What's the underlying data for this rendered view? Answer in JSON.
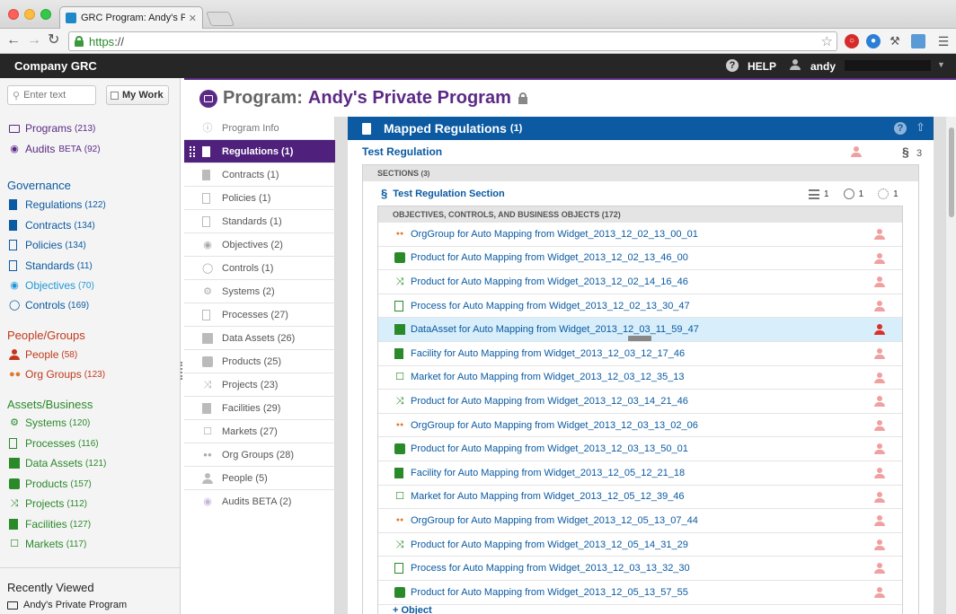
{
  "browser": {
    "tab_title": "GRC Program: Andy's Priva",
    "tab_close": "✕",
    "url_scheme": "https",
    "url_rest": "://"
  },
  "app": {
    "brand": "Company GRC",
    "help_label": "HELP",
    "user_name": "andy"
  },
  "sidebar": {
    "search_placeholder": "Enter text",
    "mywork_label": "My Work",
    "top_items": [
      {
        "label": "Programs",
        "count": "(213)",
        "color": "#5b2a86"
      },
      {
        "label": "Audits",
        "beta": "BETA",
        "count": "(92)",
        "color": "#5b2a86"
      }
    ],
    "governance": {
      "title": "Governance",
      "color": "#0b5aa2",
      "items": [
        {
          "label": "Regulations",
          "count": "(122)"
        },
        {
          "label": "Contracts",
          "count": "(134)"
        },
        {
          "label": "Policies",
          "count": "(134)"
        },
        {
          "label": "Standards",
          "count": "(11)"
        },
        {
          "label": "Objectives",
          "count": "(70)"
        },
        {
          "label": "Controls",
          "count": "(169)"
        }
      ]
    },
    "people_groups": {
      "title": "People/Groups",
      "color": "#c0391b",
      "items": [
        {
          "label": "People",
          "count": "(58)"
        },
        {
          "label": "Org Groups",
          "count": "(123)"
        }
      ]
    },
    "assets_business": {
      "title": "Assets/Business",
      "color": "#2a8a2a",
      "items": [
        {
          "label": "Systems",
          "count": "(120)"
        },
        {
          "label": "Processes",
          "count": "(116)"
        },
        {
          "label": "Data Assets",
          "count": "(121)"
        },
        {
          "label": "Products",
          "count": "(157)"
        },
        {
          "label": "Projects",
          "count": "(112)"
        },
        {
          "label": "Facilities",
          "count": "(127)"
        },
        {
          "label": "Markets",
          "count": "(117)"
        }
      ]
    },
    "recently_viewed": {
      "title": "Recently Viewed",
      "items": [
        "Andy's Private Program"
      ]
    }
  },
  "program": {
    "label": "Program:",
    "name": "Andy's Private Program"
  },
  "inner_nav": [
    {
      "label": "Program Info"
    },
    {
      "label": "Regulations (1)"
    },
    {
      "label": "Contracts (1)"
    },
    {
      "label": "Policies (1)"
    },
    {
      "label": "Standards (1)"
    },
    {
      "label": "Objectives (2)"
    },
    {
      "label": "Controls (1)"
    },
    {
      "label": "Systems (2)"
    },
    {
      "label": "Processes (27)"
    },
    {
      "label": "Data Assets (26)"
    },
    {
      "label": "Products (25)"
    },
    {
      "label": "Projects (23)"
    },
    {
      "label": "Facilities (29)"
    },
    {
      "label": "Markets (27)"
    },
    {
      "label": "Org Groups (28)"
    },
    {
      "label": "People (5)"
    },
    {
      "label": "Audits BETA (2)"
    }
  ],
  "panel": {
    "title": "Mapped Regulations",
    "count": "(1)",
    "regulation": "Test Regulation",
    "regulation_section_count": "3",
    "sections_label": "SECTIONS",
    "sections_count": "(3)",
    "section_name": "Test Regulation Section",
    "section_metrics": [
      "1",
      "1",
      "1"
    ],
    "objects_header": "OBJECTIVES, CONTROLS, AND BUSINESS OBJECTS (172)",
    "add_object": "+ Object",
    "objects": [
      {
        "type": "orggroup",
        "label": "OrgGroup for Auto Mapping from Widget_2013_12_02_13_00_01"
      },
      {
        "type": "product",
        "label": "Product for Auto Mapping from Widget_2013_12_02_13_46_00"
      },
      {
        "type": "project",
        "label": "Product for Auto Mapping from Widget_2013_12_02_14_16_46"
      },
      {
        "type": "process",
        "label": "Process for Auto Mapping from Widget_2013_12_02_13_30_47"
      },
      {
        "type": "dataasset",
        "label": "DataAsset for Auto Mapping from Widget_2013_12_03_11_59_47"
      },
      {
        "type": "facility",
        "label": "Facility for Auto Mapping from Widget_2013_12_03_12_17_46"
      },
      {
        "type": "market",
        "label": "Market for Auto Mapping from Widget_2013_12_03_12_35_13"
      },
      {
        "type": "project",
        "label": "Product for Auto Mapping from Widget_2013_12_03_14_21_46"
      },
      {
        "type": "orggroup",
        "label": "OrgGroup for Auto Mapping from Widget_2013_12_03_13_02_06"
      },
      {
        "type": "product",
        "label": "Product for Auto Mapping from Widget_2013_12_03_13_50_01"
      },
      {
        "type": "facility",
        "label": "Facility for Auto Mapping from Widget_2013_12_05_12_21_18"
      },
      {
        "type": "market",
        "label": "Market for Auto Mapping from Widget_2013_12_05_12_39_46"
      },
      {
        "type": "orggroup",
        "label": "OrgGroup for Auto Mapping from Widget_2013_12_05_13_07_44"
      },
      {
        "type": "project",
        "label": "Product for Auto Mapping from Widget_2013_12_05_14_31_29"
      },
      {
        "type": "process",
        "label": "Process for Auto Mapping from Widget_2013_12_03_13_32_30"
      },
      {
        "type": "product",
        "label": "Product for Auto Mapping from Widget_2013_12_05_13_57_55"
      }
    ]
  },
  "colors": {
    "program_purple": "#5b2a86",
    "link_blue": "#0b5aa2",
    "people_red": "#c0391b",
    "assets_green": "#2a8a2a",
    "owner_pink": "#f0a0a0",
    "owner_red": "#d9302c",
    "selected_row": "#d8eefa"
  }
}
